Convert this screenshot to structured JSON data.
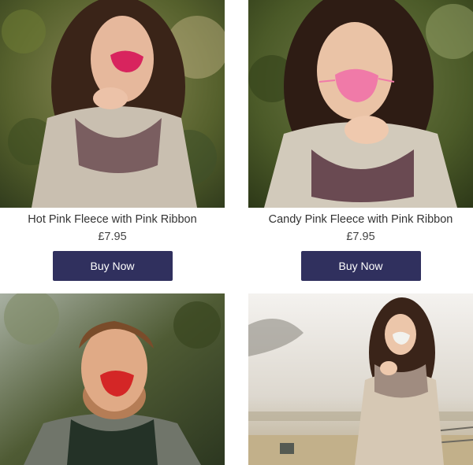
{
  "products": [
    {
      "title": "Hot Pink Fleece with Pink Ribbon",
      "price": "£7.95",
      "button": "Buy Now",
      "nose_color": "#d8245e"
    },
    {
      "title": "Candy Pink Fleece with Pink Ribbon",
      "price": "£7.95",
      "button": "Buy Now",
      "nose_color": "#f07aa8"
    },
    {
      "title": "",
      "price": "",
      "button": "",
      "nose_color": "#d42626"
    },
    {
      "title": "",
      "price": "",
      "button": "",
      "nose_color": "#f2f2ee"
    }
  ],
  "colors": {
    "button_bg": "#30305e",
    "button_text": "#ffffff",
    "text": "#333333"
  }
}
